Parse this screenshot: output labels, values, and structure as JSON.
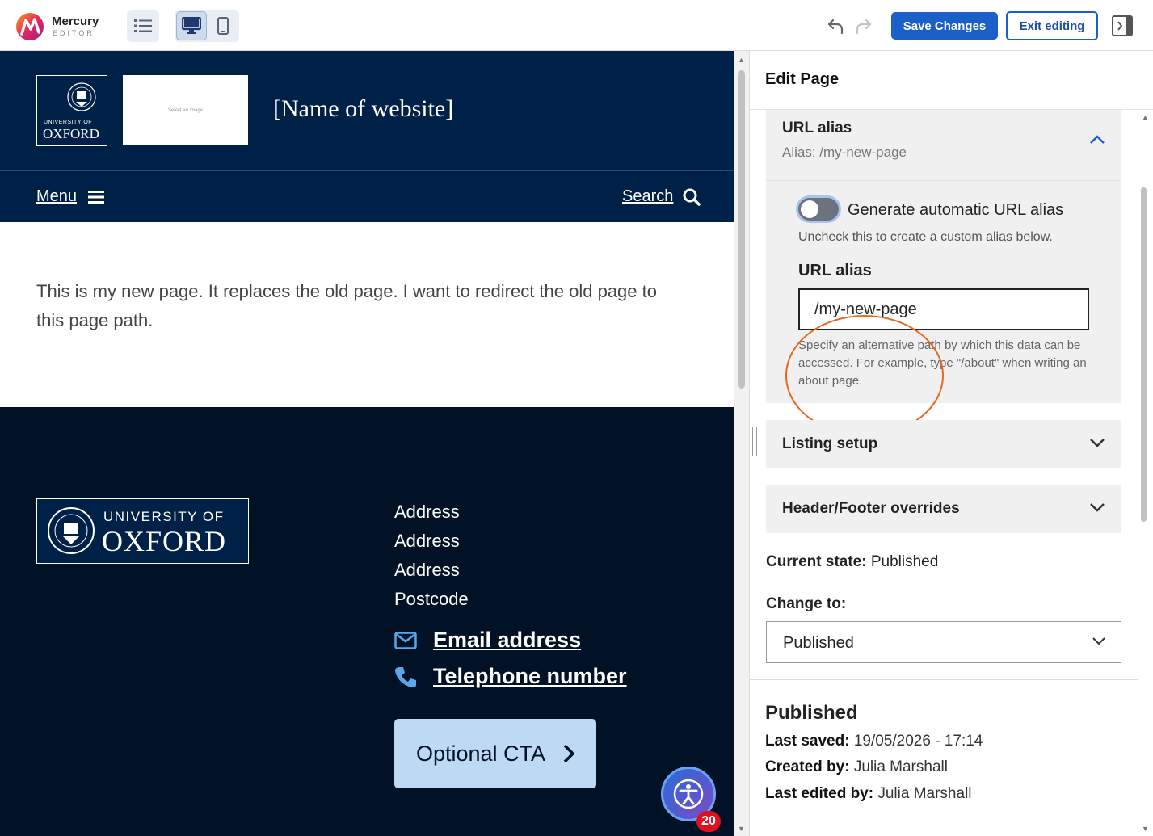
{
  "toolbar": {
    "brand": "Mercury",
    "brand_sub": "EDITOR",
    "icons": {
      "outline": "list-icon",
      "desktop": "desktop-icon",
      "mobile": "mobile-icon",
      "undo": "undo-icon",
      "redo": "redo-icon",
      "panel": "panel-collapse-icon"
    },
    "save_label": "Save Changes",
    "exit_label": "Exit editing",
    "accent": "#1b5fc9"
  },
  "site": {
    "logo_line1": "UNIVERSITY OF",
    "logo_line2": "OXFORD",
    "image_placeholder": "Select an image",
    "name": "[Name of website]",
    "menu_label": "Menu",
    "search_label": "Search",
    "body": "This is my new page. It replaces the old page. I want to redirect the old page to this page path.",
    "header_color": "#002147"
  },
  "footer": {
    "logo_line1": "UNIVERSITY OF",
    "logo_line2": "OXFORD",
    "address": [
      "Address",
      "Address",
      "Address",
      "Postcode"
    ],
    "email": "Email address",
    "phone": "Telephone number",
    "cta": "Optional CTA",
    "a11y_count": "20"
  },
  "sidebar": {
    "title": "Edit Page",
    "url_alias": {
      "title": "URL alias",
      "summary": "Alias: /my-new-page",
      "toggle_label": "Generate automatic URL alias",
      "toggle_help": "Uncheck this to create a custom alias below.",
      "field_label": "URL alias",
      "value": "/my-new-page",
      "help": "Specify an alternative path by which this data can be accessed. For example, type \"/about\" when writing an about page."
    },
    "sections": [
      "Listing setup",
      "Header/Footer overrides"
    ],
    "current_state_label": "Current state:",
    "current_state_value": "Published",
    "change_to_label": "Change to:",
    "change_to_value": "Published",
    "status_heading": "Published",
    "last_saved_label": "Last saved:",
    "last_saved_value": "19/05/2026 - 17:14",
    "created_by_label": "Created by:",
    "created_by_value": "Julia Marshall",
    "last_edited_label": "Last edited by:",
    "last_edited_value": "Julia Marshall"
  }
}
